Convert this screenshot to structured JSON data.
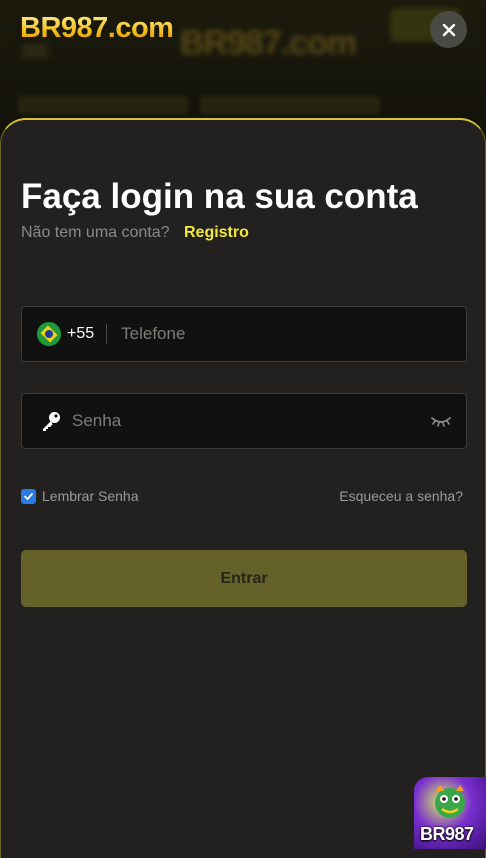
{
  "header": {
    "brand_logo": "BR987.com",
    "background_logo": "BR987.com",
    "close_icon": "close-icon"
  },
  "login": {
    "title": "Faça login na sua conta",
    "no_account_text": "Não tem uma conta?",
    "register_link": "Registro",
    "phone": {
      "flag_icon": "brazil-flag-icon",
      "country_code": "+55",
      "placeholder": "Telefone",
      "value": ""
    },
    "password": {
      "key_icon": "key-icon",
      "placeholder": "Senha",
      "value": "",
      "visibility_icon": "eye-closed-icon"
    },
    "remember": {
      "label": "Lembrar Senha",
      "checked": true
    },
    "forgot_link": "Esqueceu a senha?",
    "submit_label": "Entrar"
  },
  "promo": {
    "label": "BR987",
    "icon": "promo-game-icon"
  },
  "colors": {
    "accent": "#f2e83a",
    "sheet_background": "#222120",
    "submit_button": "#646129",
    "checkbox": "#2a7be4",
    "logo_gold": "#f4c020"
  }
}
